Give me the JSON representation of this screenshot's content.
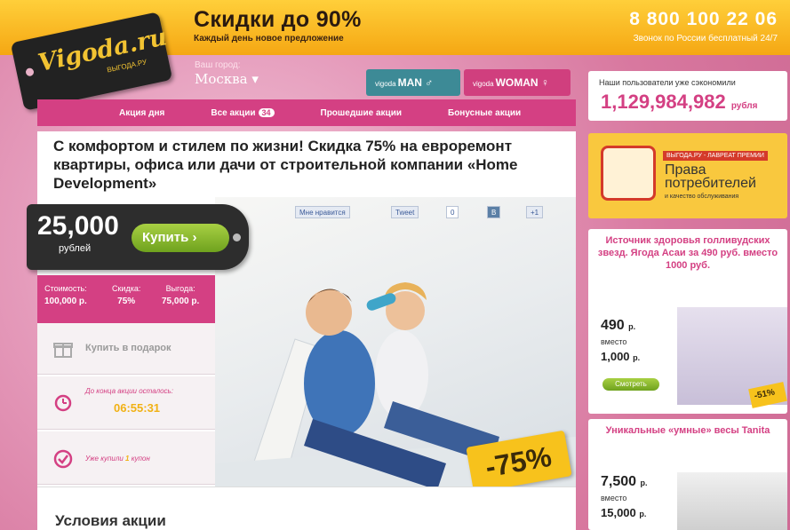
{
  "header": {
    "promo_title": "Скидки до 90%",
    "promo_sub": "Каждый день новое предложение",
    "phone": "8 800 100 22 06",
    "phone_note": "Звонок по России бесплатный 24/7"
  },
  "logo": {
    "main": "Vigoda.ru",
    "sub": "ВЫГОДА.РУ"
  },
  "city": {
    "label": "Ваш город:",
    "value": "Москва"
  },
  "gender": {
    "man": "MAN",
    "woman": "WOMAN",
    "prefix": "vigoda"
  },
  "nav": {
    "items": [
      "Акция дня",
      "Все акции",
      "Прошедшие акции",
      "Бонусные акции"
    ],
    "badge": "34"
  },
  "deal": {
    "title": "С комфортом и стилем по жизни! Скидка 75% на евроремонт квартиры, офиса или дачи от строительной компании «Home Development»",
    "price": "25,000",
    "currency": "рублей",
    "buy": "Купить",
    "stats": [
      {
        "label": "Стоимость:",
        "value": "100,000 р."
      },
      {
        "label": "Скидка:",
        "value": "75%"
      },
      {
        "label": "Выгода:",
        "value": "75,000 р."
      }
    ],
    "gift": "Купить в подарок",
    "timer_label": "До конца акции осталось:",
    "timer": "06:55:31",
    "bought_pre": "Уже купили",
    "bought_count": "1",
    "bought_post": "купон",
    "discount": "-75%",
    "social": {
      "like": "Мне нравится",
      "tweet": "Tweet",
      "tweet_count": "0",
      "vk": "B",
      "plus": "+1"
    },
    "conditions": "Условия акции"
  },
  "sidebar": {
    "saved_label": "Наши пользователи уже сэкономили",
    "saved_value": "1,129,984,982",
    "saved_unit": "рубля",
    "award_banner": "ВЫГОДА.РУ - ЛАВРЕАТ ПРЕМИИ",
    "award_main": "Права потребителей",
    "award_foot": "и качество обслуживания",
    "offer1": {
      "title": "Источник здоровья голливудских звезд. Ягода Асаи за 490 руб. вместо 1000 руб.",
      "price": "490",
      "unit": "р.",
      "was": "вместо",
      "old": "1,000",
      "old_unit": "р.",
      "btn": "Смотреть",
      "badge": "-51%"
    },
    "offer2": {
      "title": "Уникальные «умные» весы Tanita",
      "price": "7,500",
      "unit": "р.",
      "was": "вместо",
      "old": "15,000",
      "old_unit": "р."
    }
  },
  "colors": {
    "brand_pink": "#d44083",
    "accent_yellow": "#f7c21c",
    "buy_green": "#8bbd2c"
  }
}
